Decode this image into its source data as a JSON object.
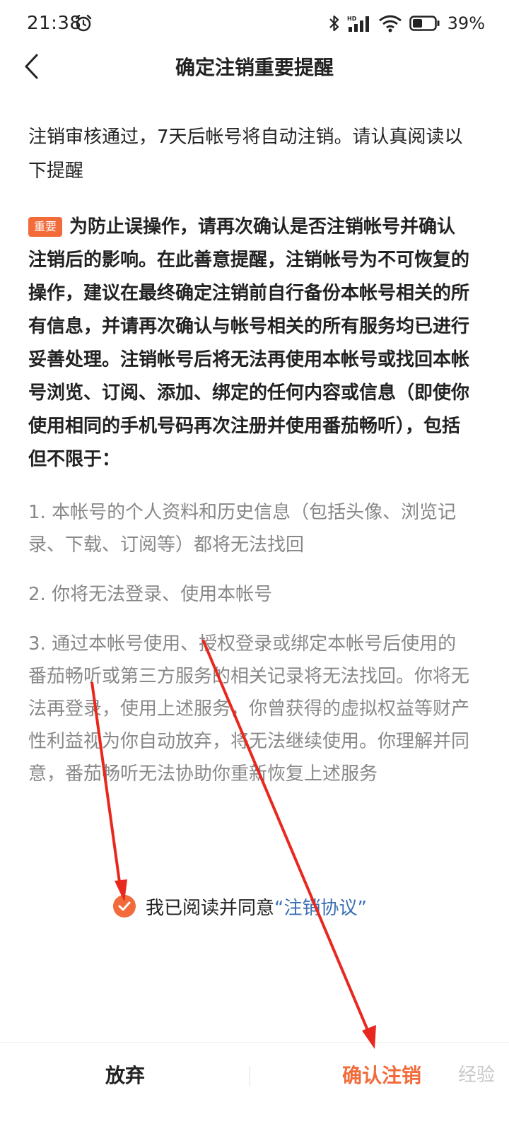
{
  "status_bar": {
    "time": "21:38",
    "battery": "39%"
  },
  "header": {
    "title": "确定注销重要提醒"
  },
  "content": {
    "intro": "注销审核通过，7天后帐号将自动注销。请认真阅读以下提醒",
    "badge": "重要",
    "important_text": "为防止误操作，请再次确认是否注销帐号并确认注销后的影响。在此善意提醒，注销帐号为不可恢复的操作，建议在最终确定注销前自行备份本帐号相关的所有信息，并请再次确认与帐号相关的所有服务均已进行妥善处理。注销帐号后将无法再使用本帐号或找回本帐号浏览、订阅、添加、绑定的任何内容或信息（即使你使用相同的手机号码再次注册并使用番茄畅听），包括但不限于：",
    "points": [
      "1. 本帐号的个人资料和历史信息（包括头像、浏览记录、下载、订阅等）都将无法找回",
      "2. 你将无法登录、使用本帐号",
      "3. 通过本帐号使用、授权登录或绑定本帐号后使用的番茄畅听或第三方服务的相关记录将无法找回。你将无法再登录，使用上述服务，你曾获得的虚拟权益等财产性利益视为你自动放弃，将无法继续使用。你理解并同意，番茄畅听无法协助你重新恢复上述服务"
    ]
  },
  "agreement": {
    "checked": true,
    "text": "我已阅读并同意",
    "link": "“注销协议”"
  },
  "footer": {
    "abandon_label": "放弃",
    "confirm_label": "确认注销"
  },
  "watermark": "经验",
  "colors": {
    "accent": "#f26b3a",
    "link": "#3b6fb5",
    "annotation_arrow": "#e8281e"
  }
}
